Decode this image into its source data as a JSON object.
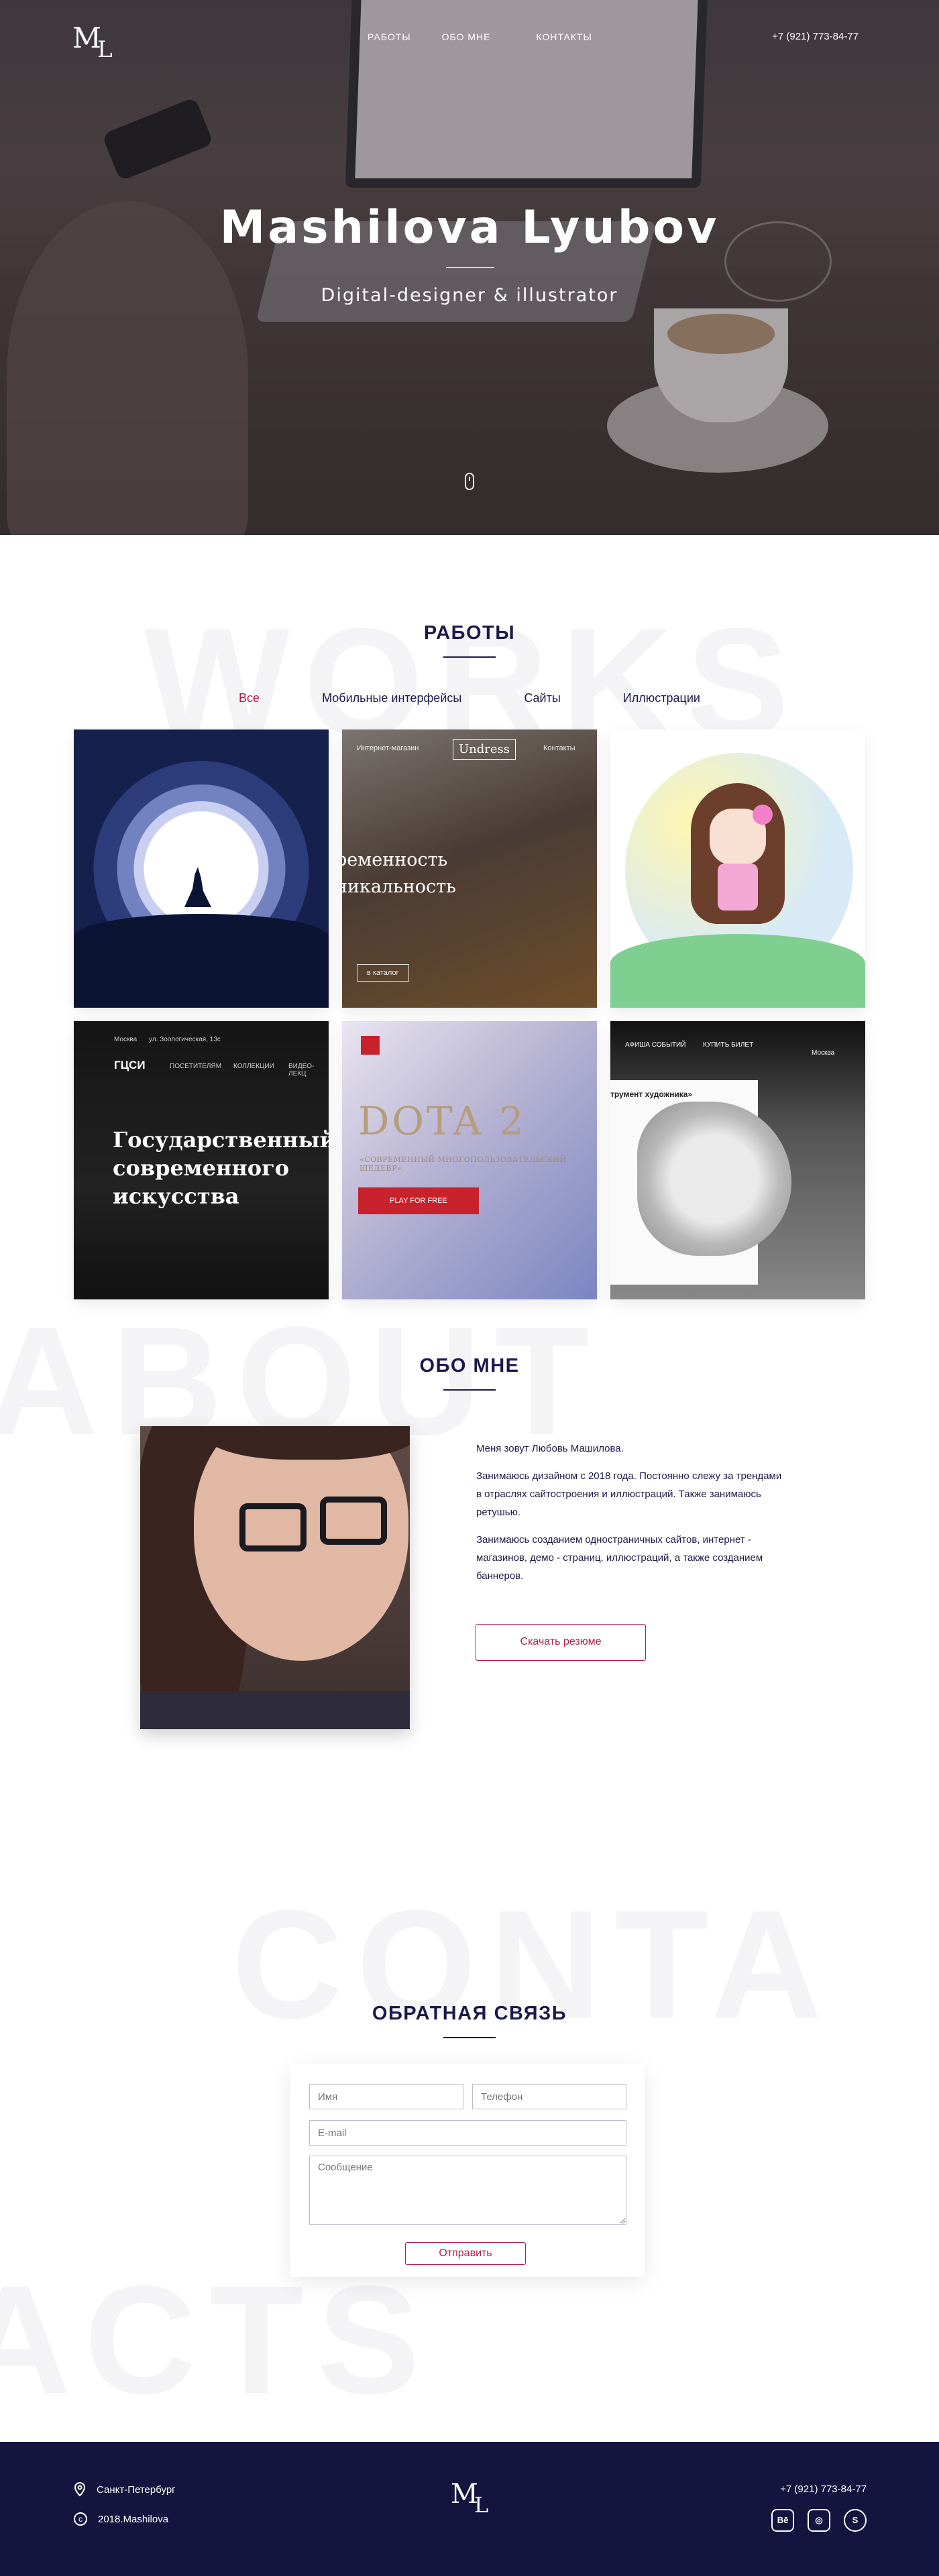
{
  "nav": {
    "logo": "ML",
    "items": [
      "РАБОТЫ",
      "ОБО МНЕ",
      "КОНТАКТЫ"
    ],
    "phone": "+7 (921) 773-84-77"
  },
  "hero": {
    "title": "Mashilova Lyubov",
    "subtitle": "Digital-designer & illustrator"
  },
  "works": {
    "bg_word": "WORKS",
    "title": "РАБОТЫ",
    "filters": [
      "Все",
      "Мобильные интерфейсы",
      "Сайты",
      "Иллюстрации"
    ],
    "active_filter": "Все",
    "cards": {
      "undress": {
        "brand": "Undress",
        "lines": [
          "ременность",
          "никальность"
        ],
        "catalog": "в каталог",
        "top_left": "Интернет-магазин",
        "top_right": "Контакты"
      },
      "gcsi": {
        "city": "Москва",
        "address": "ул. Зоологическая, 13с",
        "logo": "ГЦСИ",
        "menu": [
          "ПОСЕТИТЕЛЯМ",
          "КОЛЛЕКЦИИ",
          "ВИДЕО-ЛЕКЦ"
        ],
        "headline": [
          "Государственный",
          "современного",
          "искусства"
        ]
      },
      "dota": {
        "title": "DOTA 2",
        "tagline": "«СОВРЕМЕННЫЙ МНОГОПОЛЬЗОВАТЕЛЬСКИЙ ШЕДЕВР»",
        "button": "PLAY FOR FREE"
      },
      "robot": {
        "menu": [
          "АФИША СОБЫТИЙ",
          "КУПИТЬ БИЛЕТ"
        ],
        "city": "Москва",
        "headline": "трумент художника»"
      }
    }
  },
  "about": {
    "bg_word": "ABOUT",
    "title": "ОБО МНЕ",
    "paragraphs": [
      "Меня зовут Любовь Машилова.",
      "Занимаюсь дизайном с 2018 года. Постоянно слежу за трендами в отраслях сайтостроения и иллюстраций. Также занимаюсь ретушью.",
      "Занимаюсь созданием одностраничных сайтов, интернет - магазинов, демо - страниц, иллюстраций, а также созданием баннеров."
    ],
    "button": "Скачать резюме"
  },
  "contacts": {
    "bg_word": "CONTA",
    "bg_word2": "ACTS",
    "title": "ОБРАТНАЯ СВЯЗЬ",
    "form": {
      "name_placeholder": "Имя",
      "phone_placeholder": "Телефон",
      "email_placeholder": "E-mail",
      "message_placeholder": "Сообщение",
      "submit": "Отправить"
    }
  },
  "footer": {
    "city": "Санкт-Петербург",
    "copyright": "2018.Mashilova",
    "logo": "ML",
    "phone": "+7 (921) 773-84-77",
    "socials": [
      "behance-icon",
      "instagram-icon",
      "skype-icon"
    ]
  },
  "colors": {
    "accent": "#b01f49",
    "navy": "#1c1a4a",
    "footer_bg": "#14143f"
  }
}
